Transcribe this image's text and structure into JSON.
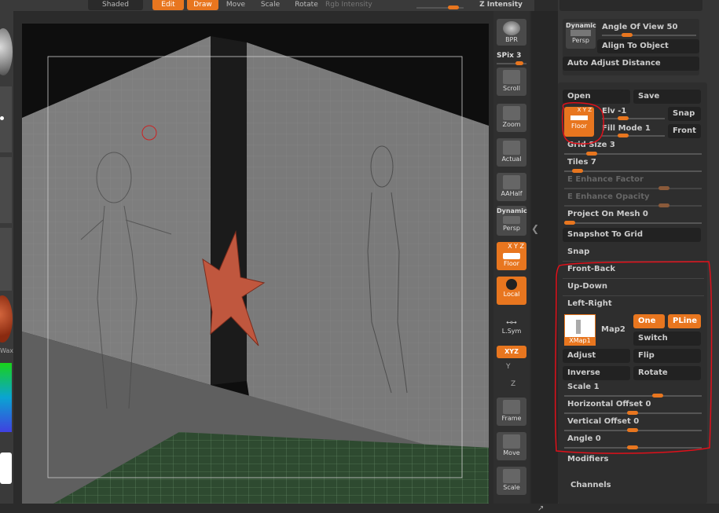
{
  "topbar": {
    "shaded": "Shaded",
    "edit": "Edit",
    "draw": "Draw",
    "move": "Move",
    "scale": "Scale",
    "rotate": "Rotate",
    "rgb_intensity": "Rgb Intensity",
    "z_intensity": "Z Intensity"
  },
  "left_strip": {
    "label": "Wax"
  },
  "right_toolbar": {
    "bpr": "BPR",
    "spix": "SPix 3",
    "scroll": "Scroll",
    "zoom": "Zoom",
    "actual": "Actual",
    "aahalf": "AAHalf",
    "dynamic": "Dynamic",
    "persp": "Persp",
    "floor_top": "X Y Z",
    "floor": "Floor",
    "local": "Local",
    "lsym": "L.Sym",
    "xyz": "XYZ",
    "y_axis": "Y",
    "z_axis": "Z",
    "frame": "Frame",
    "move": "Move",
    "scale": "Scale"
  },
  "draw_palette": {
    "dynamic": "Dynamic",
    "persp": "Persp",
    "angle_of_view": "Angle Of View 50",
    "angle_of_view_value": 50,
    "align_to_object": "Align To Object",
    "auto_adjust_distance": "Auto Adjust Distance",
    "open": "Open",
    "save": "Save",
    "floor_top": "X Y Z",
    "floor": "Floor",
    "elv": "Elv -1",
    "fill_mode": "Fill Mode 1",
    "snap_btn": "Snap",
    "front_btn": "Front",
    "grid_size": "Grid Size 3",
    "tiles": "Tiles 7",
    "e_enhance_factor": "E Enhance Factor",
    "e_enhance_opacity": "E Enhance Opacity",
    "project_on_mesh": "Project On Mesh 0",
    "snapshot_to_grid": "Snapshot To Grid",
    "snap_section": "Snap",
    "front_back": "Front-Back",
    "up_down": "Up-Down",
    "left_right": "Left-Right",
    "map_label": "Map2",
    "map_thumb": "XMap1",
    "one": "One",
    "pline": "PLine",
    "switch": "Switch",
    "adjust": "Adjust",
    "flip": "Flip",
    "inverse": "Inverse",
    "rotate": "Rotate",
    "scale": "Scale 1",
    "horizontal_offset": "Horizontal Offset 0",
    "vertical_offset": "Vertical Offset 0",
    "angle": "Angle 0",
    "modifiers": "Modifiers",
    "channels": "Channels"
  },
  "colors": {
    "accent": "#e8761f",
    "annotation": "#e0101a",
    "panel": "#353535",
    "button": "#222222"
  }
}
